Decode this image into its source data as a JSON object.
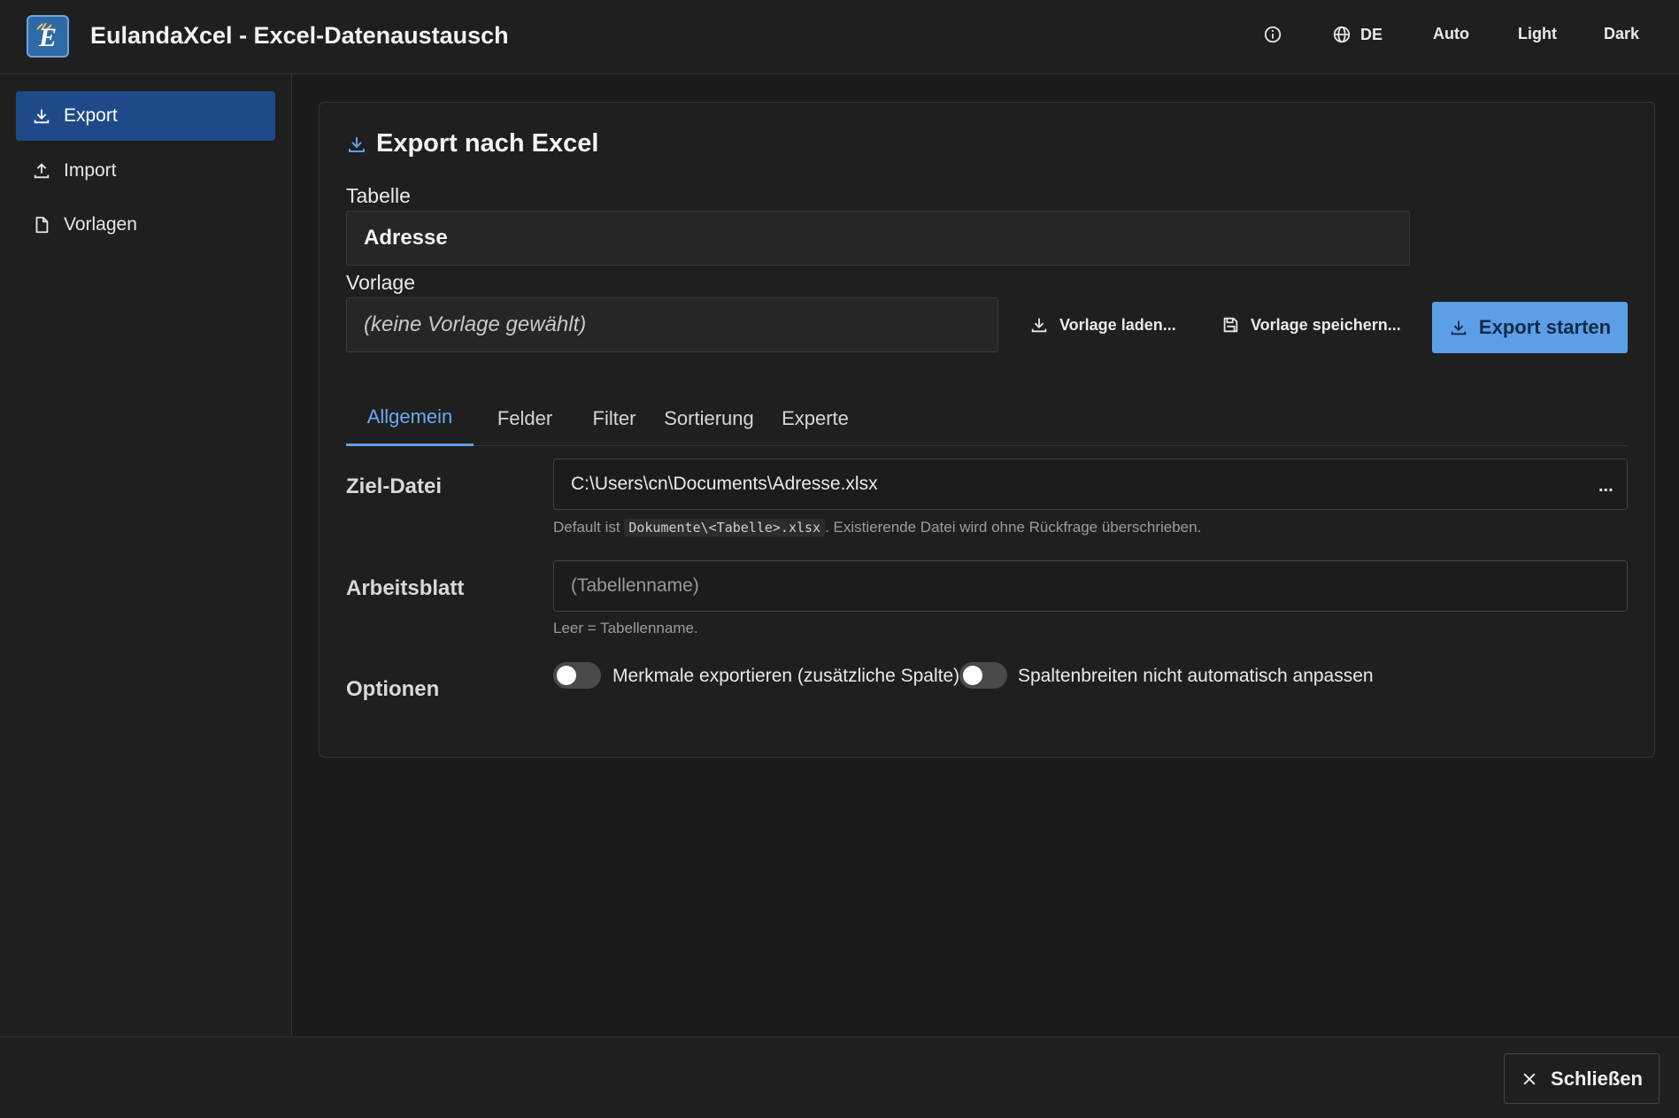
{
  "app": {
    "title": "EulandaXcel - Excel-Datenaustausch",
    "logo_letter": "E"
  },
  "header": {
    "info_icon": "info-icon",
    "language": {
      "icon": "globe-icon",
      "label": "DE"
    },
    "theme_auto": "Auto",
    "theme_light": "Light",
    "theme_dark": "Dark"
  },
  "sidebar": {
    "items": [
      {
        "label": "Export",
        "icon": "download-icon",
        "active": true
      },
      {
        "label": "Import",
        "icon": "upload-icon",
        "active": false
      },
      {
        "label": "Vorlagen",
        "icon": "file-icon",
        "active": false
      }
    ]
  },
  "main": {
    "title": "Export nach Excel",
    "table_label": "Tabelle",
    "table_value": "Adresse",
    "template_label": "Vorlage",
    "template_value": "(keine Vorlage gewählt)",
    "load_template": "Vorlage laden...",
    "save_template": "Vorlage speichern...",
    "start_export": "Export starten",
    "tabs": [
      {
        "label": "Allgemein",
        "active": true
      },
      {
        "label": "Felder",
        "active": false
      },
      {
        "label": "Filter",
        "active": false
      },
      {
        "label": "Sortierung",
        "active": false
      },
      {
        "label": "Experte",
        "active": false
      }
    ],
    "target_file": {
      "label": "Ziel-Datei",
      "value": "C:\\Users\\cn\\Documents\\Adresse.xlsx",
      "browse": "...",
      "hint_prefix": "Default ist",
      "hint_code": "Dokumente\\<Tabelle>.xlsx",
      "hint_suffix": ". Existierende Datei wird ohne Rückfrage überschrieben."
    },
    "worksheet": {
      "label": "Arbeitsblatt",
      "placeholder": "(Tabellenname)",
      "hint": "Leer = Tabellenname."
    },
    "options": {
      "label": "Optionen",
      "toggle1": {
        "label": "Merkmale exportieren (zusätzliche Spalte)",
        "on": false
      },
      "toggle2": {
        "label": "Spaltenbreiten nicht automatisch anpassen",
        "on": false
      }
    }
  },
  "footer": {
    "close_label": "Schließen"
  },
  "colors": {
    "accent": "#5d9fe6",
    "nav_active": "#1e4a8a",
    "background": "#1b1b1b"
  }
}
